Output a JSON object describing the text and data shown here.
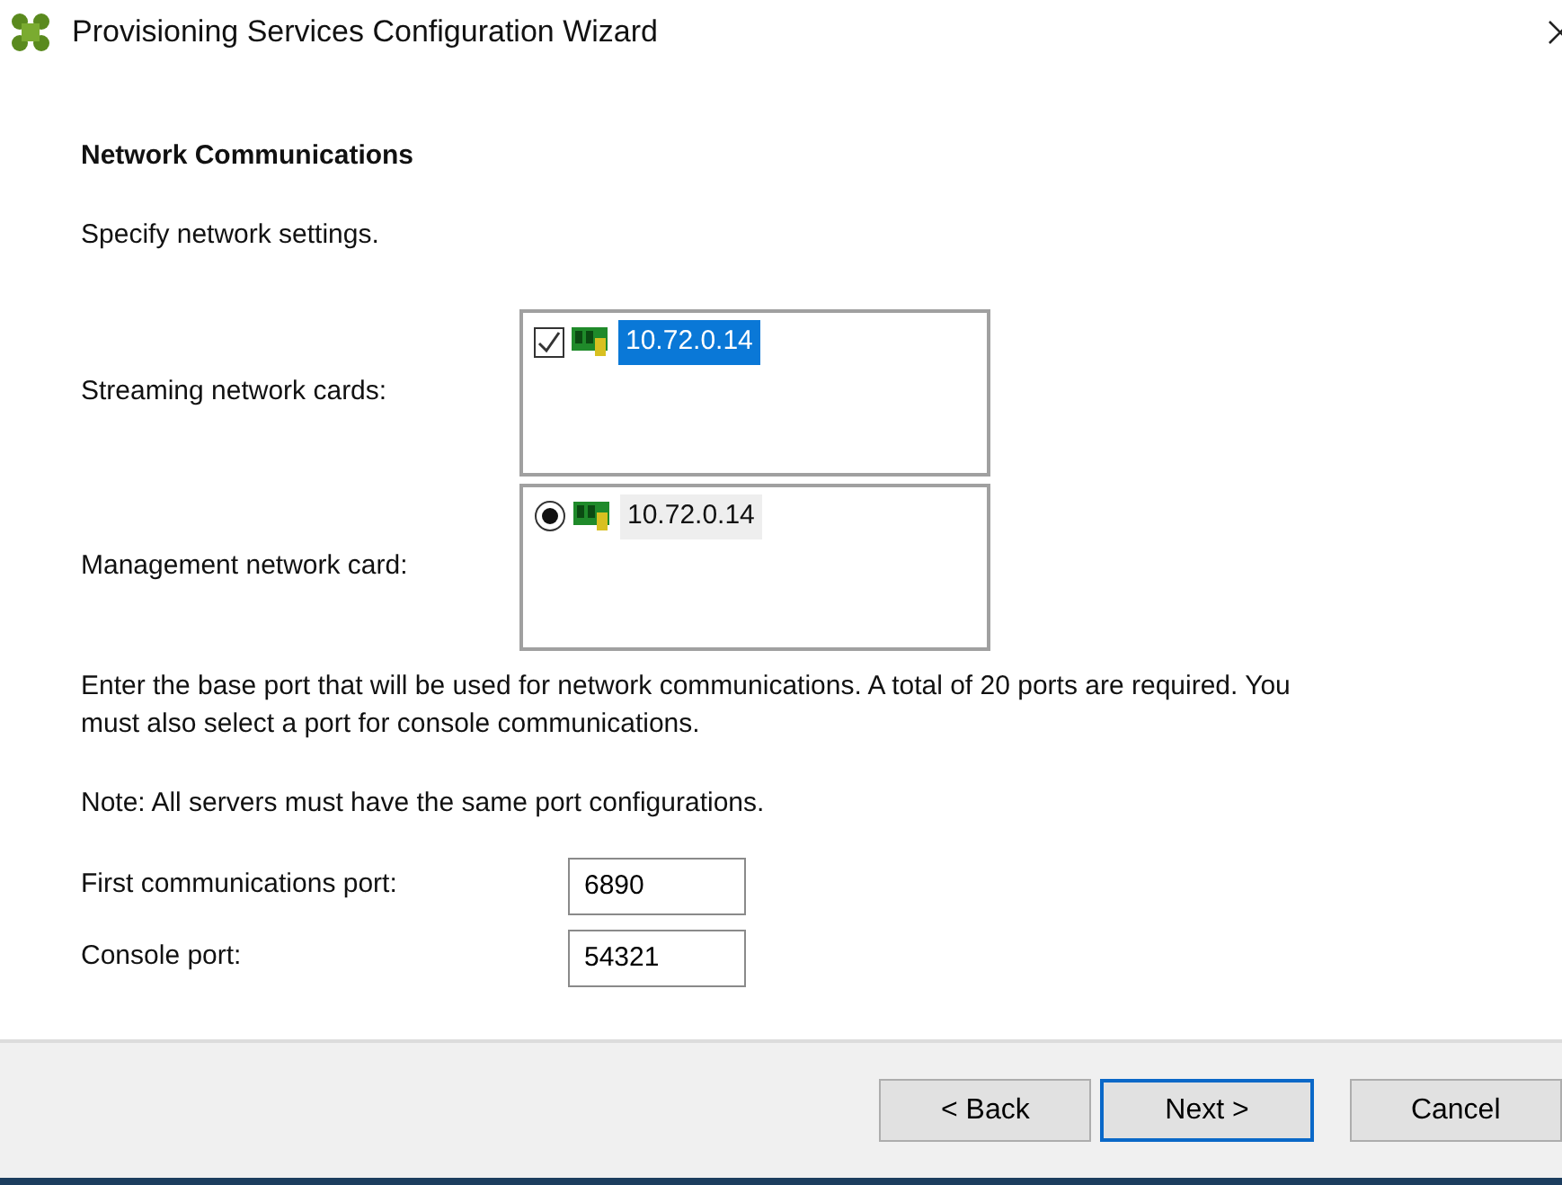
{
  "window": {
    "title": "Provisioning Services Configuration Wizard"
  },
  "heading": "Network Communications",
  "subtitle": "Specify network settings.",
  "network_lists": [
    {
      "label": "Streaming network cards:",
      "kind": "checkbox",
      "items": [
        {
          "address": "10.72.0.14",
          "checked": true,
          "highlighted": true
        }
      ]
    },
    {
      "label": "Management network card:",
      "kind": "radio",
      "items": [
        {
          "address": "10.72.0.14",
          "checked": true,
          "highlighted": false
        }
      ]
    }
  ],
  "port_description": "Enter the base port that will be used for network communications. A total of 20 ports are required. You must also select a port for console communications.",
  "note": "Note: All servers must have the same port configurations.",
  "ports": [
    {
      "label": "First communications port:",
      "value": "6890"
    },
    {
      "label": "Console port:",
      "value": "54321"
    }
  ],
  "buttons": [
    {
      "label": "< Back",
      "default": false
    },
    {
      "label": "Next >",
      "default": true
    },
    {
      "label": "Cancel",
      "default": false
    }
  ]
}
